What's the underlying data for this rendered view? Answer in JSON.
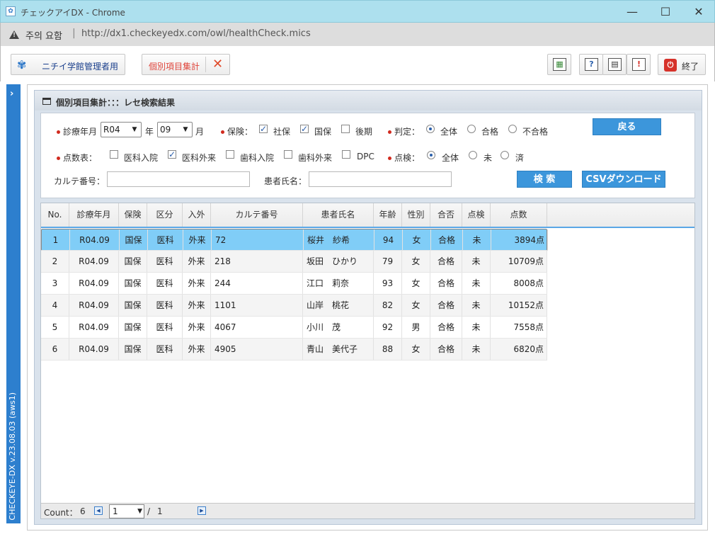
{
  "window": {
    "title": "チェックアイDX - Chrome",
    "minimize": "—",
    "maximize": "☐",
    "close": "✕"
  },
  "address_bar": {
    "security_label": "주의 요함",
    "separator": "|",
    "url": "http://dx1.checkeyedx.com/owl/healthCheck.mics"
  },
  "toolbar": {
    "org_label": "ニチイ学館管理者用",
    "active_tab_label": "個別項目集計",
    "close_tab_symbol": "✕",
    "icon_glyphs": [
      "▦",
      "?",
      "▤",
      "!"
    ],
    "exit_label": "終了",
    "exit_symbol": "⏻"
  },
  "sidebar": {
    "expand_symbol": "›",
    "version": "CHECKEYE-DX v.23.08.03 (aws1)"
  },
  "panel": {
    "title": "個別項目集計：：：レセ検索結果"
  },
  "filters": {
    "month_label": "診療年月",
    "year_value": "R04",
    "year_unit": "年",
    "month_value": "09",
    "month_unit": "月",
    "insurance_label": "保険：",
    "insurance_options": [
      {
        "label": "社保",
        "checked": true
      },
      {
        "label": "国保",
        "checked": true
      },
      {
        "label": "後期",
        "checked": false
      }
    ],
    "judgement_label": "判定：",
    "judgement_options": [
      {
        "label": "全体",
        "selected": true
      },
      {
        "label": "合格",
        "selected": false
      },
      {
        "label": "不合格",
        "selected": false
      }
    ],
    "back_button": "戻る",
    "score_table_label": "点数表：",
    "score_table_options": [
      {
        "label": "医科入院",
        "checked": false
      },
      {
        "label": "医科外来",
        "checked": true
      },
      {
        "label": "歯科入院",
        "checked": false
      },
      {
        "label": "歯科外来",
        "checked": false
      },
      {
        "label": "DPC",
        "checked": false
      }
    ],
    "check_label": "点検：",
    "check_options": [
      {
        "label": "全体",
        "selected": true
      },
      {
        "label": "未",
        "selected": false
      },
      {
        "label": "済",
        "selected": false
      }
    ],
    "chart_no_label": "カルテ番号：",
    "chart_no_value": "",
    "patient_name_label": "患者氏名：",
    "patient_name_value": "",
    "search_button": "検 索",
    "csv_button": "CSVダウンロード"
  },
  "grid": {
    "columns": [
      "No.",
      "診療年月",
      "保険",
      "区分",
      "入外",
      "カルテ番号",
      "患者氏名",
      "年齢",
      "性別",
      "合否",
      "点検",
      "点数"
    ],
    "rows": [
      [
        "1",
        "R04.09",
        "国保",
        "医科",
        "外来",
        "72",
        "桜井　紗希",
        "94",
        "女",
        "合格",
        "未",
        "3894点"
      ],
      [
        "2",
        "R04.09",
        "国保",
        "医科",
        "外来",
        "218",
        "坂田　ひかり",
        "79",
        "女",
        "合格",
        "未",
        "10709点"
      ],
      [
        "3",
        "R04.09",
        "国保",
        "医科",
        "外来",
        "244",
        "江口　莉奈",
        "93",
        "女",
        "合格",
        "未",
        "8008点"
      ],
      [
        "4",
        "R04.09",
        "国保",
        "医科",
        "外来",
        "1101",
        "山岸　桃花",
        "82",
        "女",
        "合格",
        "未",
        "10152点"
      ],
      [
        "5",
        "R04.09",
        "国保",
        "医科",
        "外来",
        "4067",
        "小川　茂",
        "92",
        "男",
        "合格",
        "未",
        "7558点"
      ],
      [
        "6",
        "R04.09",
        "国保",
        "医科",
        "外来",
        "4905",
        "青山　美代子",
        "88",
        "女",
        "合格",
        "未",
        "6820点"
      ]
    ],
    "selected_row": 0,
    "footer": {
      "count_label": "Count：",
      "count_value": "6",
      "page_prev": "◀",
      "page_value": "1",
      "page_sep": "/",
      "page_total": "1",
      "page_next": "▶"
    }
  },
  "colors": {
    "accent": "#3c96db",
    "selected_row": "#80cdf7",
    "sidebar": "#2d7fce",
    "required_dot": "#d12a1e"
  }
}
